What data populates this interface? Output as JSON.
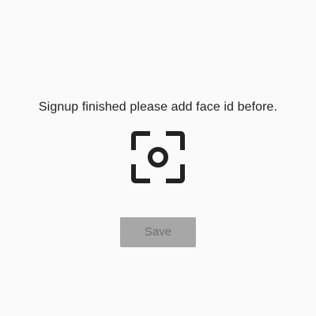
{
  "screen": {
    "message": "Signup finished please add face id before.",
    "face_id": {
      "icon": "face-id-scan-icon"
    },
    "save_button": {
      "label": "Save",
      "state": "disabled"
    }
  },
  "colors": {
    "background": "#fafafa",
    "text": "#222222",
    "icon": "#222222",
    "button_background": "#a7a7a7",
    "button_text": "#6f6f6f"
  }
}
